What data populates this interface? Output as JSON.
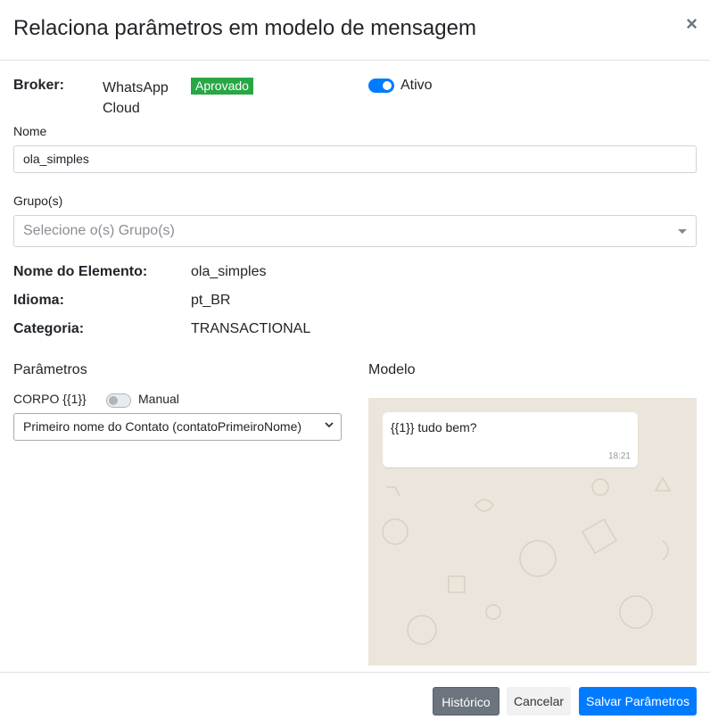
{
  "dialog": {
    "title": "Relaciona parâmetros em modelo de mensagem",
    "close_glyph": "×"
  },
  "broker": {
    "label": "Broker:",
    "value_line1": "WhatsApp",
    "value_line2": "Cloud",
    "status_badge": "Aprovado",
    "active_label": "Ativo",
    "active": true
  },
  "nome": {
    "label": "Nome",
    "value": "ola_simples"
  },
  "grupos": {
    "label": "Grupo(s)",
    "placeholder": "Selecione o(s) Grupo(s)"
  },
  "details": [
    {
      "label": "Nome do Elemento:",
      "value": "ola_simples"
    },
    {
      "label": "Idioma:",
      "value": "pt_BR"
    },
    {
      "label": "Categoria:",
      "value": "TRANSACTIONAL"
    }
  ],
  "parametros": {
    "title": "Parâmetros",
    "corpo_label": "CORPO {{1}}",
    "manual_label": "Manual",
    "manual": false,
    "selected_option": "Primeiro nome do Contato (contatoPrimeiroNome)"
  },
  "modelo": {
    "title": "Modelo",
    "message_text": "{{1}} tudo bem?",
    "message_time": "18:21"
  },
  "footer": {
    "historico_label": "Histórico",
    "cancel_label": "Cancelar",
    "save_label": "Salvar Parâmetros"
  },
  "colors": {
    "primary": "#007bff",
    "success": "#28a745",
    "secondary": "#6c757d",
    "chat_bg": "#ece5dc"
  }
}
